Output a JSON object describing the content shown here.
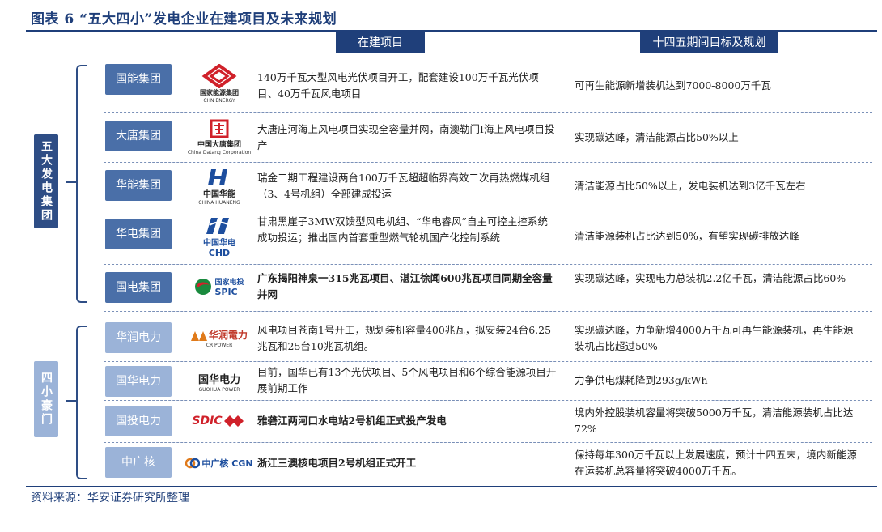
{
  "title": "图表 6 “五大四小”发电企业在建项目及未来规划",
  "headers": {
    "in_progress": "在建项目",
    "plan": "十四五期间目标及规划"
  },
  "groups": {
    "big_five": "五大发电集团",
    "small_four": "四小豪门"
  },
  "rows": [
    {
      "company": "国能集团",
      "logo_main": "国家能源集团",
      "logo_sub": "CHN ENERGY",
      "project": "140万千瓦大型风电光伏项目开工，配套建设100万千瓦光伏项目、40万千瓦风电项目",
      "plan": "可再生能源新增装机达到7000-8000万千瓦"
    },
    {
      "company": "大唐集团",
      "logo_main": "中国大唐集团",
      "logo_sub": "China Datang Corporation",
      "project": "大唐庄河海上风电项目实现全容量并网，南澳勒门I海上风电项目投产",
      "plan": "实现碳达峰，清洁能源占比50%以上"
    },
    {
      "company": "华能集团",
      "logo_main": "中国华能",
      "logo_sub": "CHINA HUANENG",
      "project": "瑞金二期工程建设两台100万千瓦超超临界高效二次再热燃煤机组（3、4号机组）全部建成投运",
      "plan": "清洁能源占比50%以上，发电装机达到3亿千瓦左右"
    },
    {
      "company": "华电集团",
      "logo_main": "中国华电",
      "logo_sub": "CHD",
      "project": "甘肃黑崖子3MW双馈型风电机组、“华电睿风”自主可控主控系统成功投运；推出国内首套重型燃气轮机国产化控制系统",
      "plan": "清洁能源装机占比达到50%，有望实现碳排放达峰"
    },
    {
      "company": "国电集团",
      "logo_main": "国家电投",
      "logo_sub": "SPIC",
      "project": "广东揭阳神泉一315兆瓦项目、湛江徐闻600兆瓦项目同期全容量并网",
      "plan": "实现碳达峰，实现电力总装机2.2亿千瓦，清洁能源占比60%"
    },
    {
      "company": "华润电力",
      "logo_main": "华润電力",
      "logo_sub": "CR POWER",
      "project": "风电项目苍南1号开工，规划装机容量400兆瓦，拟安装24台6.25兆瓦和25台10兆瓦机组。",
      "plan": "实现碳达峰，力争新增4000万千瓦可再生能源装机，再生能源装机占比超过50%"
    },
    {
      "company": "国华电力",
      "logo_main": "国华电力",
      "logo_sub": "GUOHUA POWER",
      "project": "目前，国华已有13个光伏项目、5个风电项目和6个综合能源项目开展前期工作",
      "plan": "力争供电煤耗降到293g/kWh"
    },
    {
      "company": "国投电力",
      "logo_main": "SDIC",
      "logo_sub": "",
      "project": "雅砻江两河口水电站2号机组正式投产发电",
      "plan": "境内外控股装机容量将突破5000万千瓦，清洁能源装机占比达72%"
    },
    {
      "company": "中广核",
      "logo_main": "中广核 CGN",
      "logo_sub": "",
      "project": "浙江三澳核电项目2号机组正式开工",
      "plan": "保持每年300万千瓦以上发展速度，预计十四五末，境内新能源在运装机总容量将突破4000万千瓦。"
    }
  ],
  "source": "资料来源：华安证券研究所整理",
  "colors": {
    "navy": "#1f3f7a",
    "button_dark": "#4a6fa8",
    "button_light": "#9bb3d8",
    "logo_red": "#d0212a"
  }
}
